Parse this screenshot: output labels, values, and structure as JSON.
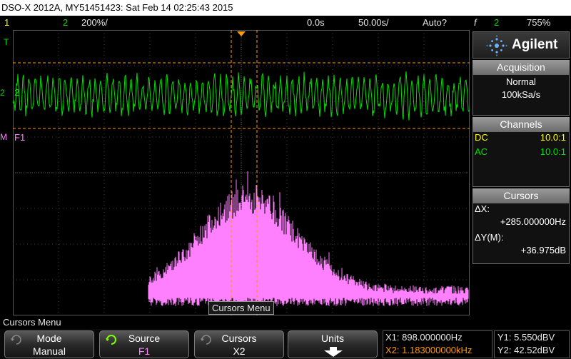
{
  "title": "DSO-X 2012A, MY51451423: Sat Feb 14 02:25:43 2015",
  "status": {
    "ch1_num": "1",
    "ch2_num": "2",
    "ch2_scale": "200%/",
    "time_offset": "0.0s",
    "time_scale": "50.00s/",
    "trigger_mode": "Auto?",
    "trigger_icon": "f",
    "trigger_source": "2",
    "trigger_level": "755%"
  },
  "markers": {
    "t_marker": "T",
    "ch2_marker": "2",
    "ch2_label": "2",
    "math_marker": "M",
    "math_label": "F1"
  },
  "logo": {
    "name": "Agilent",
    "icon": "agilent-spark-icon"
  },
  "acquisition": {
    "header": "Acquisition",
    "mode": "Normal",
    "rate": "100kSa/s"
  },
  "channels": {
    "header": "Channels",
    "rows": [
      {
        "coupling": "DC",
        "probe": "10.0:1",
        "color": "#ffff00"
      },
      {
        "coupling": "AC",
        "probe": "10.0:1",
        "color": "#00e000"
      }
    ]
  },
  "cursors": {
    "header": "Cursors",
    "dx_label": "ΔX:",
    "dx_value": "+285.000000Hz",
    "dy_label": "ΔY(M):",
    "dy_value": "+36.975dB"
  },
  "tooltip": "Cursors Menu",
  "menu_title": "Cursors Menu",
  "softkeys": [
    {
      "label": "Mode",
      "value": "Manual",
      "icon": "rotate-knob-icon"
    },
    {
      "label": "Source",
      "value": "F1",
      "icon": "rotate-knob-active-icon"
    },
    {
      "label": "Cursors",
      "value": "X2",
      "icon": "rotate-knob-icon"
    },
    {
      "label": "Units",
      "value": "",
      "icon": "down-arrow-icon"
    }
  ],
  "readout": {
    "x1": "X1: 898.000000Hz",
    "x2": "X2: 1.183000000kHz",
    "y1": "Y1: 5.550dBV",
    "y2": "Y2: 42.52dBV"
  },
  "colors": {
    "ch1": "#ffff00",
    "ch2": "#00e000",
    "math": "#ff80ff",
    "cursor": "#ff9900"
  }
}
